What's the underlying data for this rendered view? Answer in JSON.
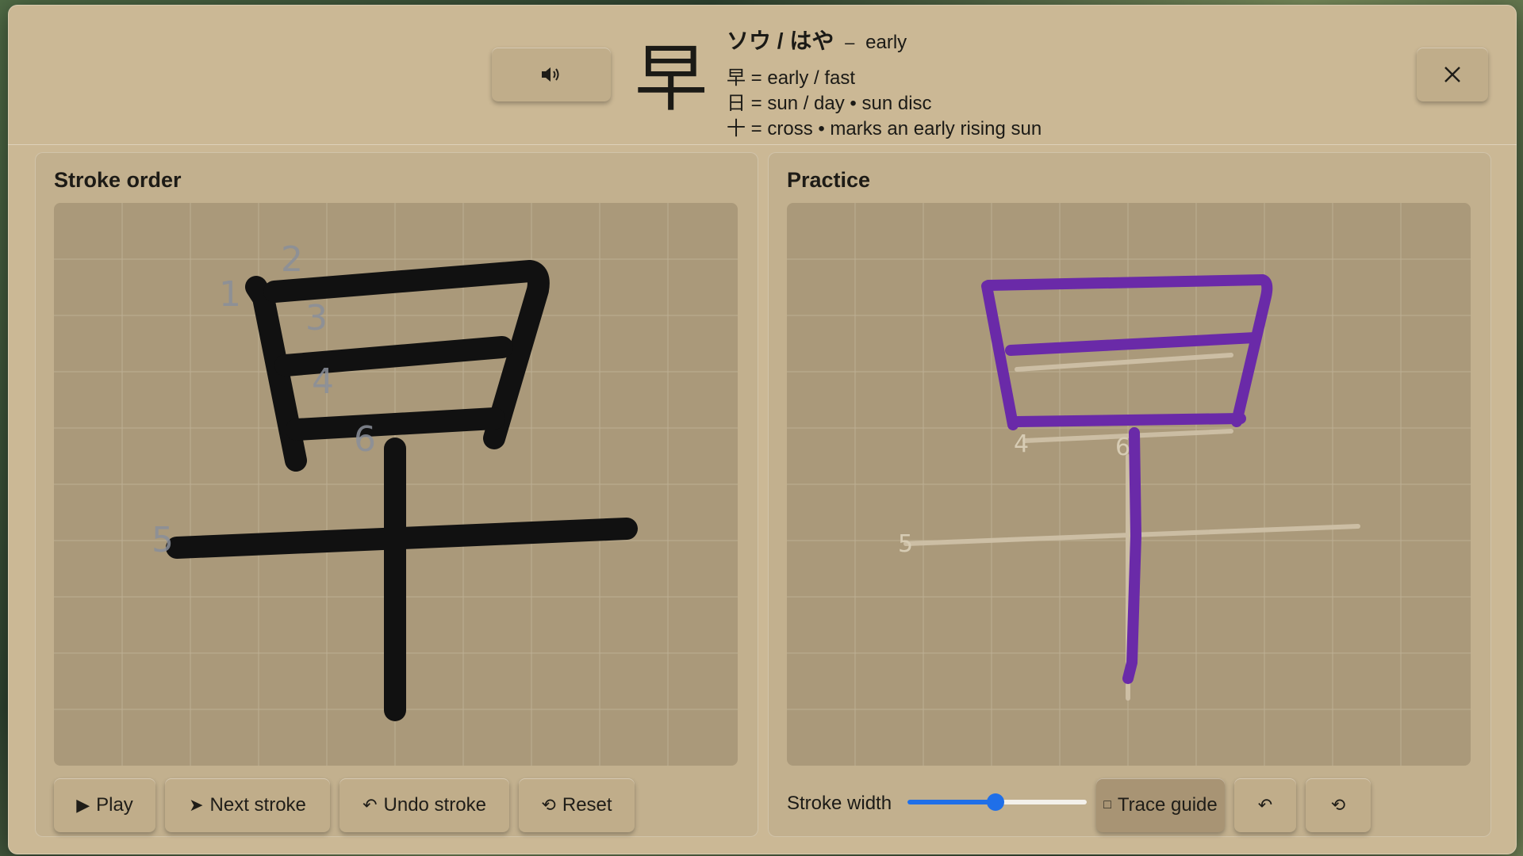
{
  "header": {
    "kanji": "早",
    "reading": "ソウ / はや",
    "dash": "–",
    "meaning": "early",
    "components": [
      "早 = early / fast",
      "日 = sun / day • sun disc",
      "十 = cross • marks an early rising sun"
    ],
    "audio_icon": "speaker-icon",
    "close_icon": "close-icon"
  },
  "stroke_order": {
    "title": "Stroke order",
    "stroke_numbers": [
      "1",
      "2",
      "3",
      "4",
      "5",
      "6"
    ],
    "buttons": {
      "play": "Play",
      "next": "Next stroke",
      "undo": "Undo stroke",
      "reset": "Reset"
    },
    "icons": {
      "play": "▶",
      "next": "➤",
      "undo": "↶",
      "reset": "⟲"
    }
  },
  "practice": {
    "title": "Practice",
    "guide_numbers": [
      "4",
      "6",
      "5"
    ],
    "stroke_width_label": "Stroke width",
    "stroke_width_value": 0.49,
    "trace_guide_label": "Trace guide",
    "trace_icon": "□",
    "undo_icon": "↶",
    "reset_icon": "⟲",
    "ink_color": "#6a2aa8",
    "slider_color": "#1f6fe8"
  }
}
